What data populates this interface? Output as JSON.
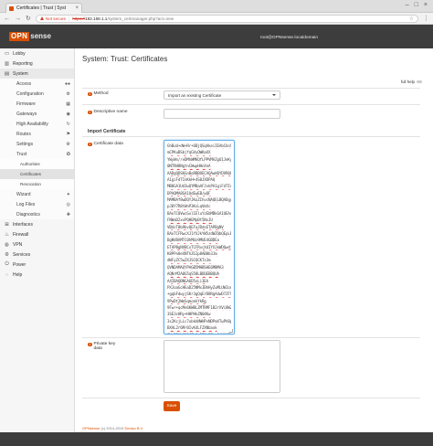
{
  "browser": {
    "tab_title": "Certificates | Trust | Syst",
    "tab_close": "×",
    "insecure_label": "Not secure",
    "url_scheme": "https://",
    "url_host": "192.168.1.1",
    "url_path": "/system_certmanager.php?act=new"
  },
  "header": {
    "brand": "OPN",
    "brand_suffix": "sense",
    "user": "root@OPNsense.localdomain"
  },
  "sidebar": {
    "items": [
      {
        "label": "Lobby",
        "icon": "laptop-icon"
      },
      {
        "label": "Reporting",
        "icon": "chart-icon"
      },
      {
        "label": "System",
        "icon": "server-icon"
      }
    ],
    "system_sub": [
      {
        "label": "Access",
        "icon": "users-icon"
      },
      {
        "label": "Configuration",
        "icon": "gears-icon"
      },
      {
        "label": "Firmware",
        "icon": "building-icon"
      },
      {
        "label": "Gateways",
        "icon": "location-icon"
      },
      {
        "label": "High Availability",
        "icon": "refresh-icon"
      },
      {
        "label": "Routes",
        "icon": "map-signs-icon"
      },
      {
        "label": "Settings",
        "icon": "cogs-icon"
      },
      {
        "label": "Trust",
        "icon": "certificate-icon"
      }
    ],
    "trust_sub": [
      {
        "label": "Authorities"
      },
      {
        "label": "Certificates"
      },
      {
        "label": "Revocation"
      }
    ],
    "system_sub_after": [
      {
        "label": "Wizard",
        "icon": "magic-icon"
      },
      {
        "label": "Log Files",
        "icon": "eye-icon"
      },
      {
        "label": "Diagnostics",
        "icon": "medkit-icon"
      }
    ],
    "items_after": [
      {
        "label": "Interfaces",
        "icon": "sitemap-icon"
      },
      {
        "label": "Firewall",
        "icon": "fire-icon"
      },
      {
        "label": "VPN",
        "icon": "globe-icon"
      },
      {
        "label": "Services",
        "icon": "cog-icon"
      },
      {
        "label": "Power",
        "icon": "plug-icon"
      },
      {
        "label": "Help",
        "icon": "support-icon"
      }
    ]
  },
  "page": {
    "title": "System: Trust: Certificates",
    "full_help": "full help",
    "method_label": "Method",
    "method_value": "Import an existing Certificate",
    "descriptive_name_label": "Descriptive name",
    "descriptive_name_value": "",
    "section_import": "Import Certificate",
    "certificate_data_label": "Certificate data",
    "certificate_lines": [
      "GhBuU+dW+Rr+6BjQSqAkeiIEAbCbnSyeeWfKmRLlLtY",
      "mCPKuBSbjfqGVyQWKaXX",
      "YWyWn//eDMhWMKQfLPPVMAZgO1JeKyXTNLUEHNQ",
      "0NTRH8NgtnCWwpHHnXnA",
      "AADgQDSKGnBoRBBOECAQAwHQYDVR0OBBYEFJvkP",
      "A1giFdTInKkH+4S0JXDPAQ",
      "MB8GA1UdIwQYMBaAFJvkPA1giFdTInKkH+4S0JX",
      "DPAQMA8GA1UdEwEB/wQF",
      "MAMBAf8wDQYJKoZIhvcNAQELBQADggEBAHJ1pkd4",
      "pJ0Y7R8tWnP3KsLqVmXc",
      "BAoTC0VwcGxlIEluYzEbMBkGA1UEAxMSVGVzdEN",
      "FNWaD2xxPQHEMpBt5NxJU",
      "VB4sT8b9bvQEFaJDdsETAPBgNV",
      "BAoTCFRwcXJ1YXJkYW5zdWZQbQEpLEwHWVE4xEsk",
      "BgNVBAMTC0hMUz9MUE4GBDEa",
      "ETAPBgNVBCxTCFRvcXdIYXJkWDQwdjRJXoZPhcNAQ",
      "K8PPn0eXNThZG1p8AB0b3Jm",
      "dWFyZC5wZXJSCQCKTs3m",
      "QVNDAMAQYPAGB5MHBSHE6MBMA3",
      "AQNrM2A0G5qS58LBDQEBBQUA",
      "A4IBAQBNGA6D5xLi3EA",
      "PXJoaGcHEaD25NMxIBhHyZuMLUWIonwkg6V6NBMBJgBq3ciK3c",
      "+gqbFdwyjSKr3gQqErD8RgAdwD7ZFS5dTbaGsVuL+sPD",
      "9PwDt2WmSqmcmkYkRg",
      "9Fwr+qcMe6KWBLZMTRMF1B2rXVi8WZhHnZE8va",
      "3SE3cHRy+HHPHkZN04Kw",
      "3s2KcjLLc7ubkkNWHPvNDPmXTwPhBpOX+NuW8zs1",
      "BXAL2r6Mr0IvK4LFZXNbaxk",
      "8YwDBKbNM6fZ+9wBZKy2E==6dVHV7Hbw/pqZXTl",
      "ImJ0pcaE5/6kV+LBtZ5MHEM8ZEbHrq2AR",
      "SQiLiG0+8B0MfdVbFnnBPHvmPPHnNF1",
      "-----END CERTIFICATE-----"
    ],
    "private_key_label": "Private key data",
    "save_label": "Save"
  },
  "footer": {
    "brand": "OPNsense",
    "copyright": " (c) 2014-2019 ",
    "vendor": "Deciso B.V."
  }
}
